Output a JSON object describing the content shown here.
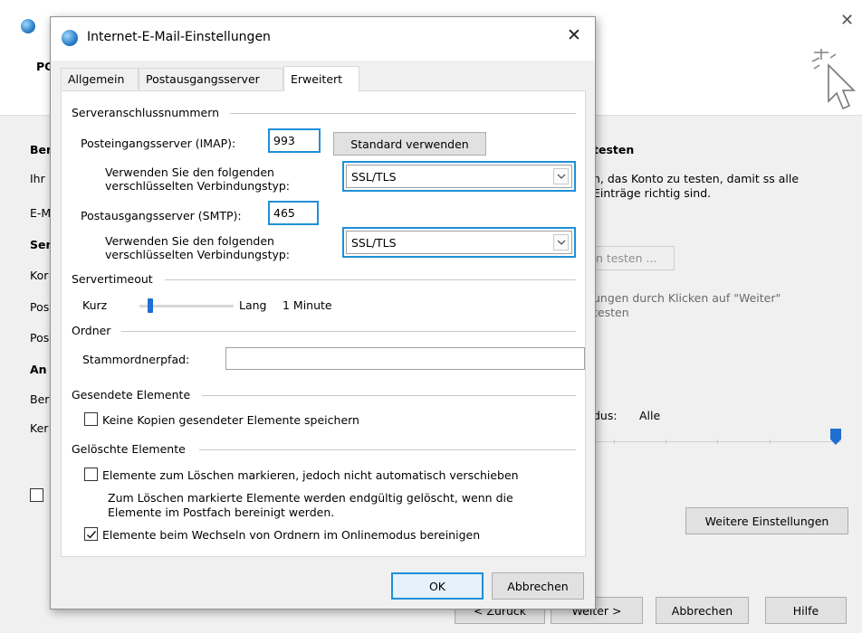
{
  "background_window": {
    "left_labels": [
      "Ber",
      "Ihr",
      "E-M",
      "Ser",
      "Kor",
      "Pos",
      "Pos",
      "An",
      "Ber",
      "Ker"
    ],
    "test_heading": "testen",
    "test_text": "n, das Konto zu testen, damit ss alle Einträge richtig sind.",
    "test_button": "n testen ...",
    "hint_text": "ungen durch Klicken auf \"Weiter\" testen",
    "mode_label": "dus:",
    "mode_value": "Alle",
    "more_settings": "Weitere Einstellungen",
    "back": "< Zurück",
    "next": "Weiter >",
    "cancel": "Abbrechen",
    "help": "Hilfe"
  },
  "dialog": {
    "title": "Internet-E-Mail-Einstellungen",
    "tabs": [
      {
        "label": "Allgemein",
        "active": false
      },
      {
        "label": "Postausgangsserver",
        "active": false
      },
      {
        "label": "Erweitert",
        "active": true
      }
    ],
    "server_ports": {
      "title": "Serveranschlussnummern",
      "incoming_label": "Posteingangsserver (IMAP):",
      "incoming_value": "993",
      "default_button": "Standard verwenden",
      "encryption_label_1": "Verwenden Sie den folgenden",
      "encryption_label_2": "verschlüsselten Verbindungstyp:",
      "incoming_encryption": "SSL/TLS",
      "outgoing_label": "Postausgangsserver (SMTP):",
      "outgoing_value": "465",
      "outgoing_encryption": "SSL/TLS"
    },
    "timeout": {
      "title": "Servertimeout",
      "short": "Kurz",
      "long": "Lang",
      "value": "1 Minute",
      "level": 0.1
    },
    "folders": {
      "title": "Ordner",
      "root_label": "Stammordnerpfad:",
      "root_value": ""
    },
    "sent": {
      "title": "Gesendete Elemente",
      "no_copies_label": "Keine Kopien gesendeter Elemente speichern",
      "no_copies_checked": false
    },
    "deleted": {
      "title": "Gelöschte Elemente",
      "mark_label": "Elemente zum Löschen markieren, jedoch nicht automatisch verschieben",
      "mark_checked": false,
      "note_1": "Zum Löschen markierte Elemente werden endgültig gelöscht, wenn die",
      "note_2": "Elemente im Postfach bereinigt werden.",
      "purge_label": "Elemente beim Wechseln von Ordnern im Onlinemodus bereinigen",
      "purge_checked": true
    },
    "ok": "OK",
    "cancel": "Abbrechen"
  },
  "colors": {
    "highlight": "#1e90d6",
    "slider": "#1f6fd1"
  }
}
